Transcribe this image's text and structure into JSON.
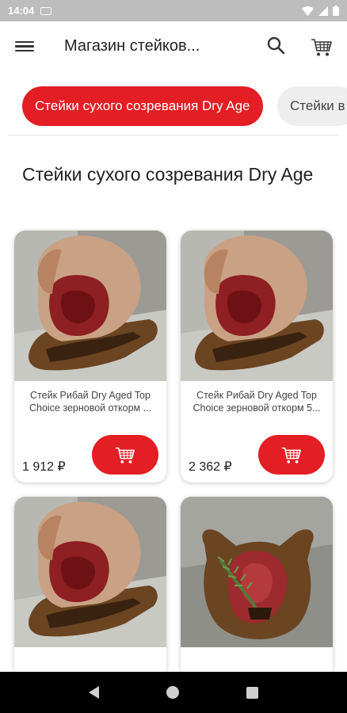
{
  "status_bar": {
    "time": "14:04"
  },
  "app_bar": {
    "title": "Магазин стейков..."
  },
  "categories": [
    {
      "label": "Стейки сухого созревания Dry Age",
      "active": true
    },
    {
      "label": "Стейки в",
      "active": false
    }
  ],
  "section": {
    "title": "Стейки сухого созревания Dry Age"
  },
  "products": [
    {
      "name": "Стейк Рибай Dry Aged Top Choice  зерновой откорм ...",
      "price": "1 912 ₽",
      "image": "ribeye-on-board"
    },
    {
      "name": "Стейк Рибай Dry Aged Top Choice зерновой откорм 5...",
      "price": "2 362 ₽",
      "image": "ribeye-on-board"
    },
    {
      "name": "",
      "price": "",
      "image": "ribeye-on-board"
    },
    {
      "name": "",
      "price": "",
      "image": "steak-in-bull-board"
    }
  ],
  "colors": {
    "accent": "#e31e24",
    "status_bar": "#bdbdbd"
  },
  "icons": [
    "menu-icon",
    "search-icon",
    "cart-icon",
    "add-to-cart-icon"
  ]
}
